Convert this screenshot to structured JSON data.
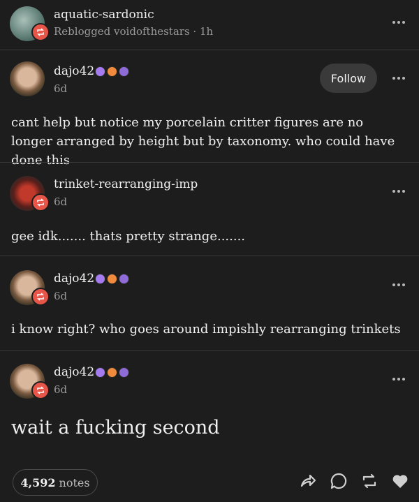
{
  "reblog_header": {
    "username": "aquatic-sardonic",
    "subtitle": "Reblogged voidofthestars · 1h"
  },
  "posts": [
    {
      "username": "dajo42",
      "time": "6d",
      "follow_label": "Follow",
      "text": "cant help but notice my porcelain critter figures are no longer arranged by height but by taxonomy. who could have done this"
    },
    {
      "username": "trinket-rearranging-imp",
      "time": "6d",
      "text": "gee idk.......  thats pretty strange......."
    },
    {
      "username": "dajo42",
      "time": "6d",
      "text": "i know right? who goes around impishly rearranging trinkets"
    },
    {
      "username": "dajo42",
      "time": "6d",
      "text": "wait a fucking second"
    }
  ],
  "footer": {
    "notes_count": "4,592",
    "notes_label": "notes"
  },
  "colors": {
    "background": "#1d1d1d",
    "reblog_badge": "#e8564a",
    "accent_purple": "#a57cf0",
    "accent_orange": "#f08a3c"
  }
}
